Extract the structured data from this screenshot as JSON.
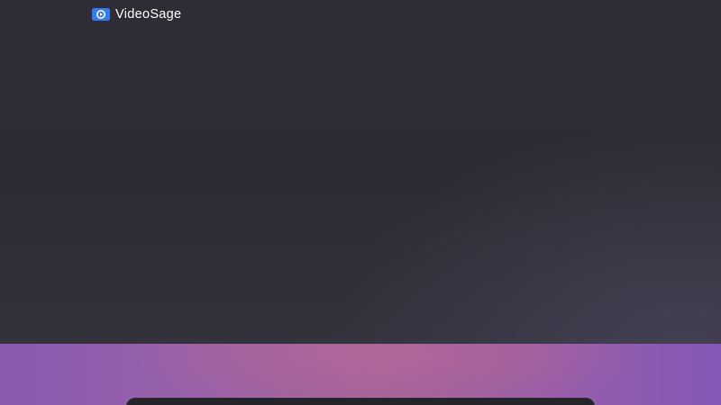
{
  "brand": {
    "name": "VideoSage",
    "icon": "video-chat-icon"
  },
  "colors": {
    "hero_background": "#2d2c34",
    "band_left": "#8a5ab0",
    "band_center": "#a3659a",
    "band_right": "#8458b8",
    "card_background": "#25242a",
    "icon_blue": "#2f7cf6"
  }
}
